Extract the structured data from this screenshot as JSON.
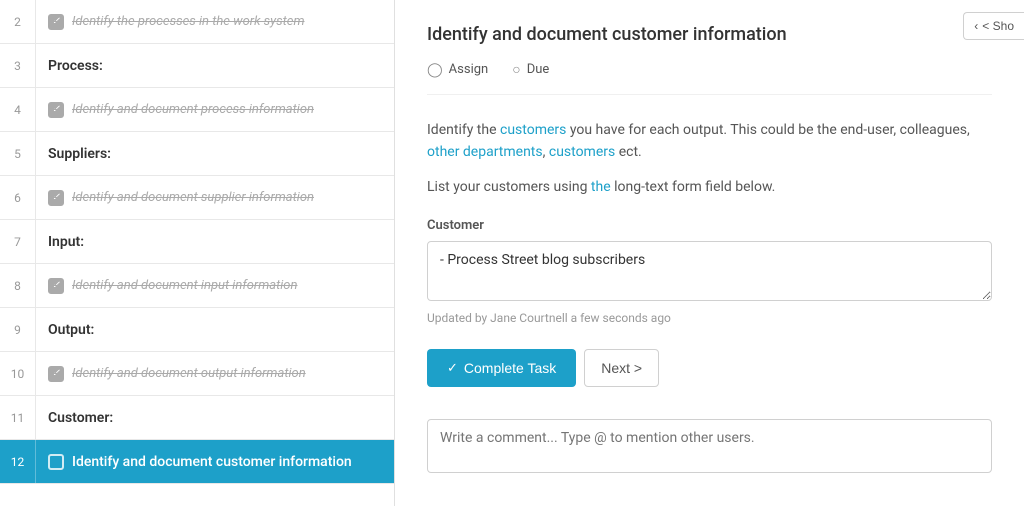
{
  "sidebar": {
    "rows": [
      {
        "num": "2",
        "type": "task",
        "checked": true,
        "label": "Identify the processes in the work system"
      },
      {
        "num": "3",
        "type": "section",
        "label": "Process:"
      },
      {
        "num": "4",
        "type": "task",
        "checked": true,
        "label": "Identify and document process information"
      },
      {
        "num": "5",
        "type": "section",
        "label": "Suppliers:"
      },
      {
        "num": "6",
        "type": "task",
        "checked": true,
        "label": "Identify and document supplier information"
      },
      {
        "num": "7",
        "type": "section",
        "label": "Input:"
      },
      {
        "num": "8",
        "type": "task",
        "checked": true,
        "label": "Identify and document input information"
      },
      {
        "num": "9",
        "type": "section",
        "label": "Output:"
      },
      {
        "num": "10",
        "type": "task",
        "checked": true,
        "label": "Identify and document output information"
      },
      {
        "num": "11",
        "type": "section",
        "label": "Customer:"
      },
      {
        "num": "12",
        "type": "active",
        "checked": false,
        "label": "Identify and document customer information"
      }
    ]
  },
  "main": {
    "title": "Identify and document customer information",
    "assign_label": "Assign",
    "due_label": "Due",
    "description_line1": "Identify the customers you have for each output. This could be the end-user, colleagues, other departments, customers ect.",
    "description_line2": "List your customers using the long-text form field below.",
    "form_label": "Customer",
    "form_value": "- Process Street blog subscribers",
    "updated_text": "Updated by Jane Courtnell a few seconds ago",
    "complete_label": "Complete Task",
    "next_label": "Next >",
    "comment_placeholder": "Write a comment... Type @ to mention other users.",
    "show_label": "< Sho"
  }
}
